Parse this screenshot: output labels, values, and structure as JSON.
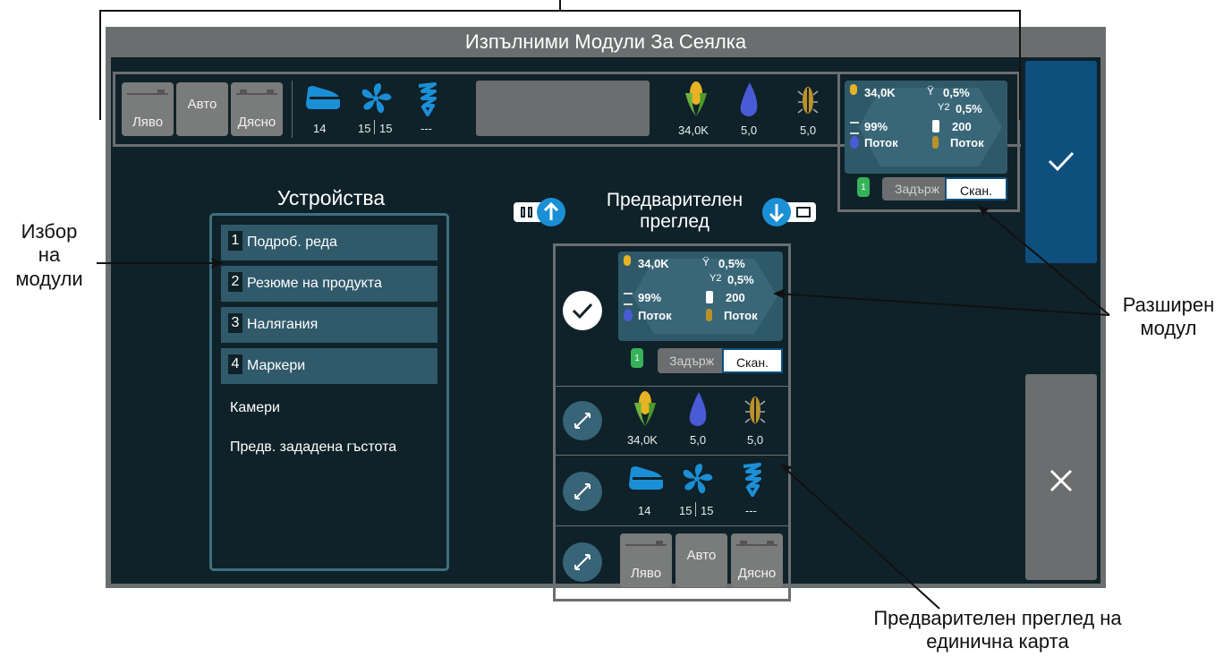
{
  "screen": {
    "title": "Изпълними Модули За Сеялка",
    "confirm_icon": "check-icon",
    "cancel_icon": "close-icon",
    "colors": {
      "bg": "#0f2229",
      "frame": "#6b6e6f",
      "module": "#2f5968",
      "accent_blue": "#1b8fd6",
      "confirm": "#0e4f7e"
    }
  },
  "top_bar": {
    "left_label": "Ляво",
    "auto_label": "Авто",
    "right_label": "Дясно",
    "planter_value": "14",
    "fan_value_1": "15",
    "fan_value_2": "15",
    "auger_value": "---",
    "seed_value": "34,0K",
    "liquid_value": "5,0",
    "insect_value": "5,0"
  },
  "expanded": {
    "population": "34,0K",
    "singulation": "99%",
    "liquid": "Поток",
    "skips": "0,5%",
    "doubles_label": "2",
    "doubles": "0,5%",
    "spacing": "200",
    "insect": "Поток",
    "row_badge": "1",
    "hold_label": "Задърж",
    "scan_label": "Скан."
  },
  "preview": {
    "title_line1": "Предварителен",
    "title_line2": "преглед",
    "up_icon": "two-column-up-icon",
    "down_icon": "single-column-down-icon"
  },
  "devices": {
    "title": "Устройства",
    "items": [
      {
        "num": "1",
        "label": "Подроб. реда"
      },
      {
        "num": "2",
        "label": "Резюме на продукта"
      },
      {
        "num": "3",
        "label": "Налягания"
      },
      {
        "num": "4",
        "label": "Маркери"
      }
    ],
    "plain_items": [
      "Камери",
      "Предв. зададена гъстота"
    ]
  },
  "callouts": {
    "module_select": [
      "Избор",
      "на",
      "модули"
    ],
    "expanded_module": [
      "Разширен",
      "модул"
    ],
    "single_card": [
      "Предварителен преглед на",
      "единична карта"
    ]
  }
}
